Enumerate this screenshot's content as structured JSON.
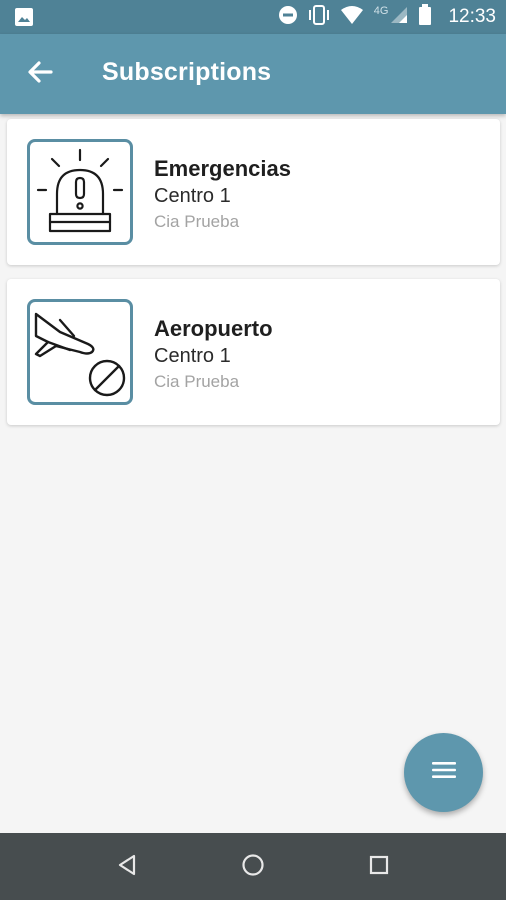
{
  "status_bar": {
    "time": "12:33",
    "network": "4G",
    "icons": [
      "gallery-icon",
      "do-not-disturb-icon",
      "vibrate-icon",
      "wifi-icon",
      "signal-icon",
      "battery-icon"
    ]
  },
  "app_bar": {
    "title": "Subscriptions",
    "back_icon": "arrow-left-icon"
  },
  "subscriptions": [
    {
      "name": "Emergencias",
      "center": "Centro 1",
      "company": "Cia Prueba",
      "icon": "siren-icon"
    },
    {
      "name": "Aeropuerto",
      "center": "Centro 1",
      "company": "Cia Prueba",
      "icon": "flight-cancelled-icon"
    }
  ],
  "fab": {
    "icon": "menu-icon"
  },
  "nav_bar": {
    "icons": [
      "back-triangle-icon",
      "home-circle-icon",
      "recents-square-icon"
    ]
  },
  "colors": {
    "status_bar": "#4f8296",
    "app_bar": "#5e97ad",
    "icon_border": "#5a8ea3",
    "background": "#f5f5f5",
    "nav_bar": "#474d4f"
  }
}
